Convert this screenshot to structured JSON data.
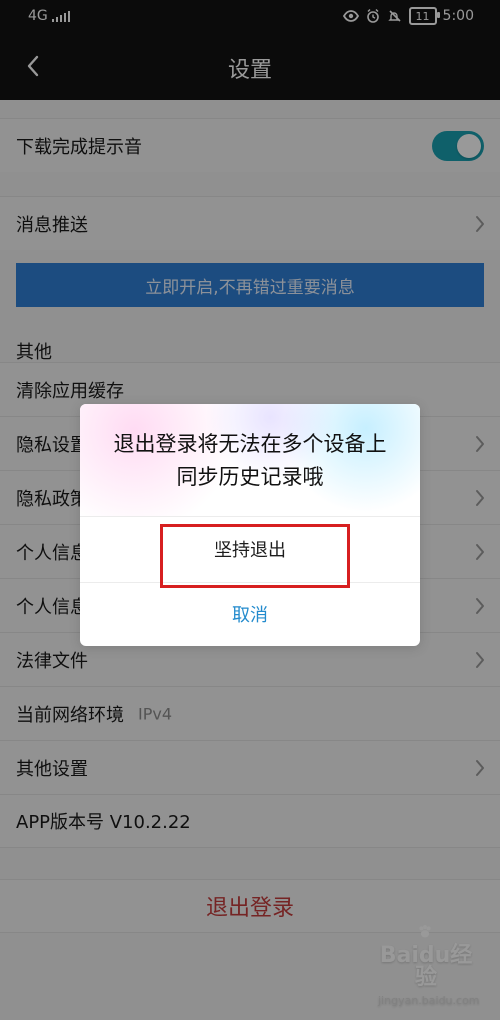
{
  "status_bar": {
    "network": "4G",
    "battery": "11",
    "time": "5:00"
  },
  "header": {
    "title": "设置"
  },
  "settings": {
    "download_sound": {
      "label": "下载完成提示音",
      "enabled": true
    },
    "message_push": {
      "label": "消息推送"
    },
    "banner_text": "立即开启,不再错过重要消息",
    "section_other": "其他",
    "items": [
      {
        "label": "清除应用缓存"
      },
      {
        "label": "隐私设置"
      },
      {
        "label": "隐私政策"
      },
      {
        "label": "个人信息"
      },
      {
        "label": "个人信息"
      },
      {
        "label": "法律文件"
      },
      {
        "label": "当前网络环境"
      },
      {
        "label": "其他设置"
      },
      {
        "label": "APP版本号 V10.2.22"
      }
    ],
    "network_value": "IPv4",
    "logout_label": "退出登录"
  },
  "dialog": {
    "message": "退出登录将无法在多个设备上同步历史记录哦",
    "confirm_label": "坚持退出",
    "cancel_label": "取消"
  },
  "watermark": {
    "brand": "Baidu经验",
    "url": "jingyan.baidu.com"
  },
  "colors": {
    "toggle_on": "#1aa0b1",
    "banner": "#2f7fd5",
    "danger": "#c43c3c",
    "dialog_action": "#238bcd",
    "highlight": "#d71f20"
  }
}
